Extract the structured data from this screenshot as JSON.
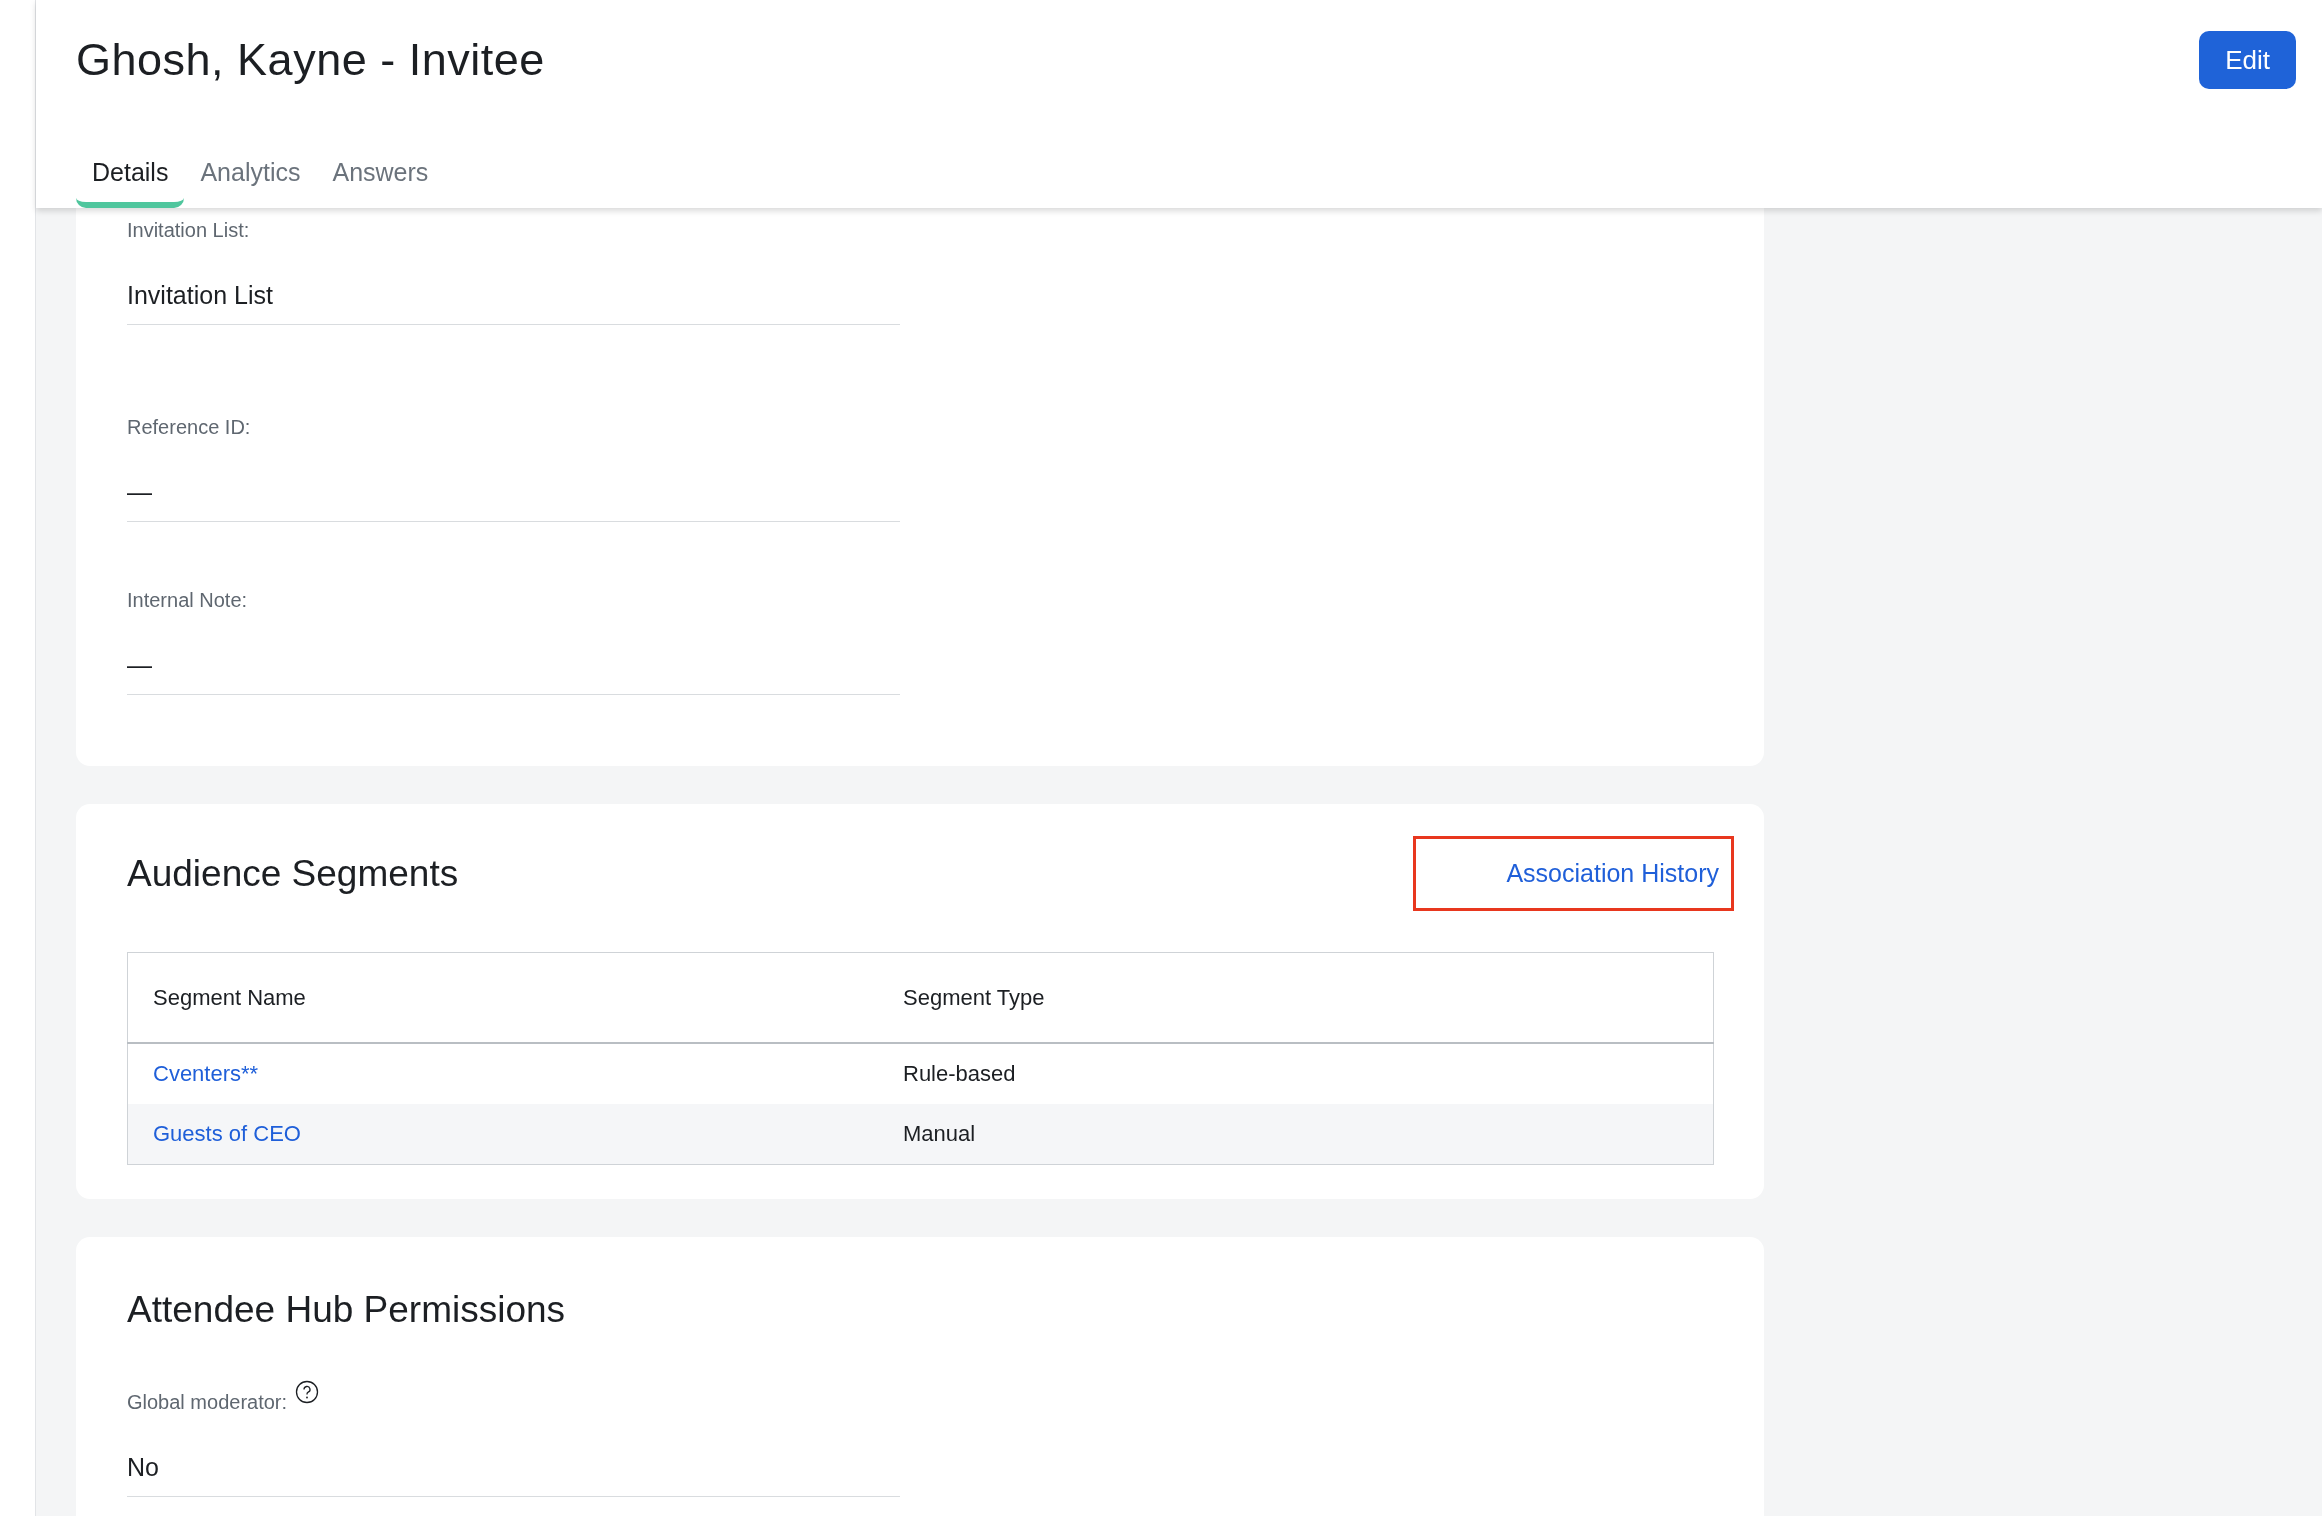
{
  "header": {
    "title": "Ghosh, Kayne - Invitee",
    "edit_button": "Edit",
    "tabs": [
      {
        "label": "Details",
        "selected": true
      },
      {
        "label": "Analytics",
        "selected": false
      },
      {
        "label": "Answers",
        "selected": false
      }
    ]
  },
  "general_fields": [
    {
      "label": "Invitation List:",
      "value": "Invitation List"
    },
    {
      "label": "Reference ID:",
      "value": "—"
    },
    {
      "label": "Internal Note:",
      "value": "—"
    }
  ],
  "audience_segments": {
    "title": "Audience Segments",
    "association_history": {
      "label": "Association History",
      "highlighted": true
    },
    "columns": [
      "Segment Name",
      "Segment Type"
    ],
    "rows": [
      {
        "name": "Cventers**",
        "type": "Rule-based"
      },
      {
        "name": "Guests of CEO",
        "type": "Manual"
      }
    ]
  },
  "attendee_hub_permissions": {
    "title": "Attendee Hub Permissions",
    "fields": [
      {
        "label": "Global moderator:",
        "help": true,
        "value": "No"
      }
    ]
  }
}
